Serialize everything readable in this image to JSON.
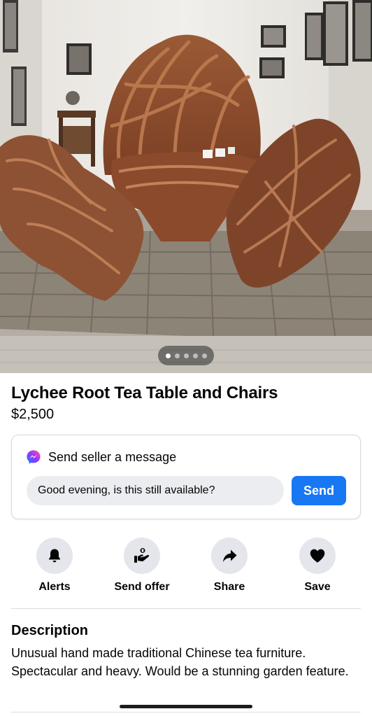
{
  "listing": {
    "title": "Lychee Root Tea Table and Chairs",
    "price": "$2,500",
    "photo": {
      "alt": "Lychee root tea table and chairs",
      "photo_index": 1,
      "photo_count": 5
    }
  },
  "message": {
    "heading": "Send seller a message",
    "icon": "messenger-icon",
    "input_value": "Good evening, is this still available?",
    "send_label": "Send"
  },
  "actions": [
    {
      "label": "Alerts",
      "icon": "bell-icon"
    },
    {
      "label": "Send offer",
      "icon": "offer-icon"
    },
    {
      "label": "Share",
      "icon": "share-icon"
    },
    {
      "label": "Save",
      "icon": "heart-icon"
    }
  ],
  "description": {
    "heading": "Description",
    "body": "Unusual hand made traditional Chinese tea furniture. Spectacular and heavy. Would be a stunning garden feature."
  },
  "colors": {
    "accent": "#1877f2",
    "icon_circle": "#e4e6eb",
    "divider": "#dadde1"
  }
}
